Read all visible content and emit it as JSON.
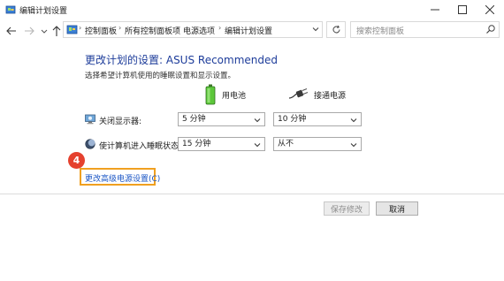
{
  "window": {
    "title": "编辑计划设置",
    "controls": [
      "minimize",
      "maximize",
      "close"
    ]
  },
  "address_bar": {
    "breadcrumbs": [
      "控制面板",
      "所有控制面板项",
      "电源选项",
      "编辑计划设置"
    ],
    "search_placeholder": "搜索控制面板"
  },
  "main": {
    "heading": "更改计划的设置: ASUS Recommended",
    "subheading": "选择希望计算机使用的睡眠设置和显示设置。",
    "columns": {
      "battery_label": "用电池",
      "plugged_label": "接通电源"
    },
    "settings": [
      {
        "label": "关闭显示器:",
        "battery_value": "5 分钟",
        "plugged_value": "10 分钟"
      },
      {
        "label": "使计算机进入睡眠状态:",
        "battery_value": "15 分钟",
        "plugged_value": "从不"
      }
    ],
    "step_badge": "4",
    "advanced_link": "更改高级电源设置(C)"
  },
  "footer": {
    "save_label": "保存修改",
    "cancel_label": "取消"
  },
  "colors": {
    "heading": "#1d3c9a",
    "link": "#1a55c5",
    "highlight_border": "#f0a020",
    "badge": "#e5412e"
  }
}
